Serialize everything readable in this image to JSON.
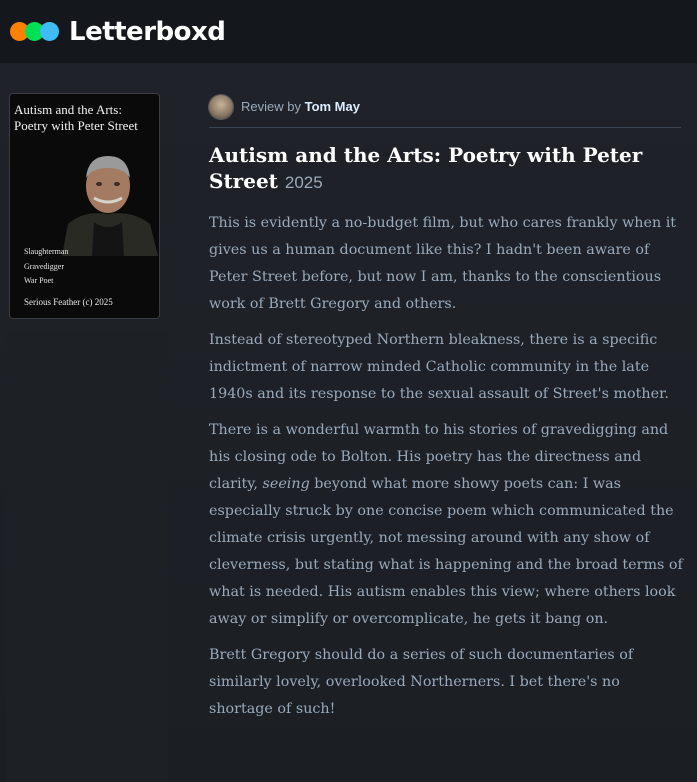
{
  "brand": {
    "name": "Letterboxd",
    "dot_colors": [
      "#ff8000",
      "#00e054",
      "#40bcf4"
    ]
  },
  "poster": {
    "title_lines": [
      "Autism and the Arts:",
      "Poetry with Peter Street"
    ],
    "roles": [
      "Slaughterman",
      "Gravedigger",
      "War Poet"
    ],
    "credit": "Serious Feather (c) 2025"
  },
  "review": {
    "by_label": "Review by",
    "reviewer": "Tom May",
    "film_title": "Autism and the Arts: Poetry with Peter Street",
    "year": "2025",
    "paragraphs": [
      "This is evidently a no-budget film, but who cares frankly when it gives us a human document like this? I hadn't been aware of Peter Street before, but now I am, thanks to the conscientious work of Brett Gregory and others.",
      "Instead of stereotyped Northern bleakness, there is a specific indictment of narrow minded Catholic community in the late 1940s and its response to the sexual assault of Street's mother.",
      "There is a wonderful warmth to his stories of gravedigging and his closing ode to Bolton. His poetry has the directness and clarity,",
      "seeing",
      "beyond what more showy poets can: I was especially struck by one concise poem which communicated the climate crisis urgently, not messing around with any show of cleverness, but stating what is happening and the broad terms of what is needed. His autism enables this view; where others look away or simplify or overcomplicate, he gets it bang on.",
      "Brett Gregory should do a series of such documentaries of similarly lovely, overlooked Northerners. I bet there's no shortage of such!"
    ]
  }
}
